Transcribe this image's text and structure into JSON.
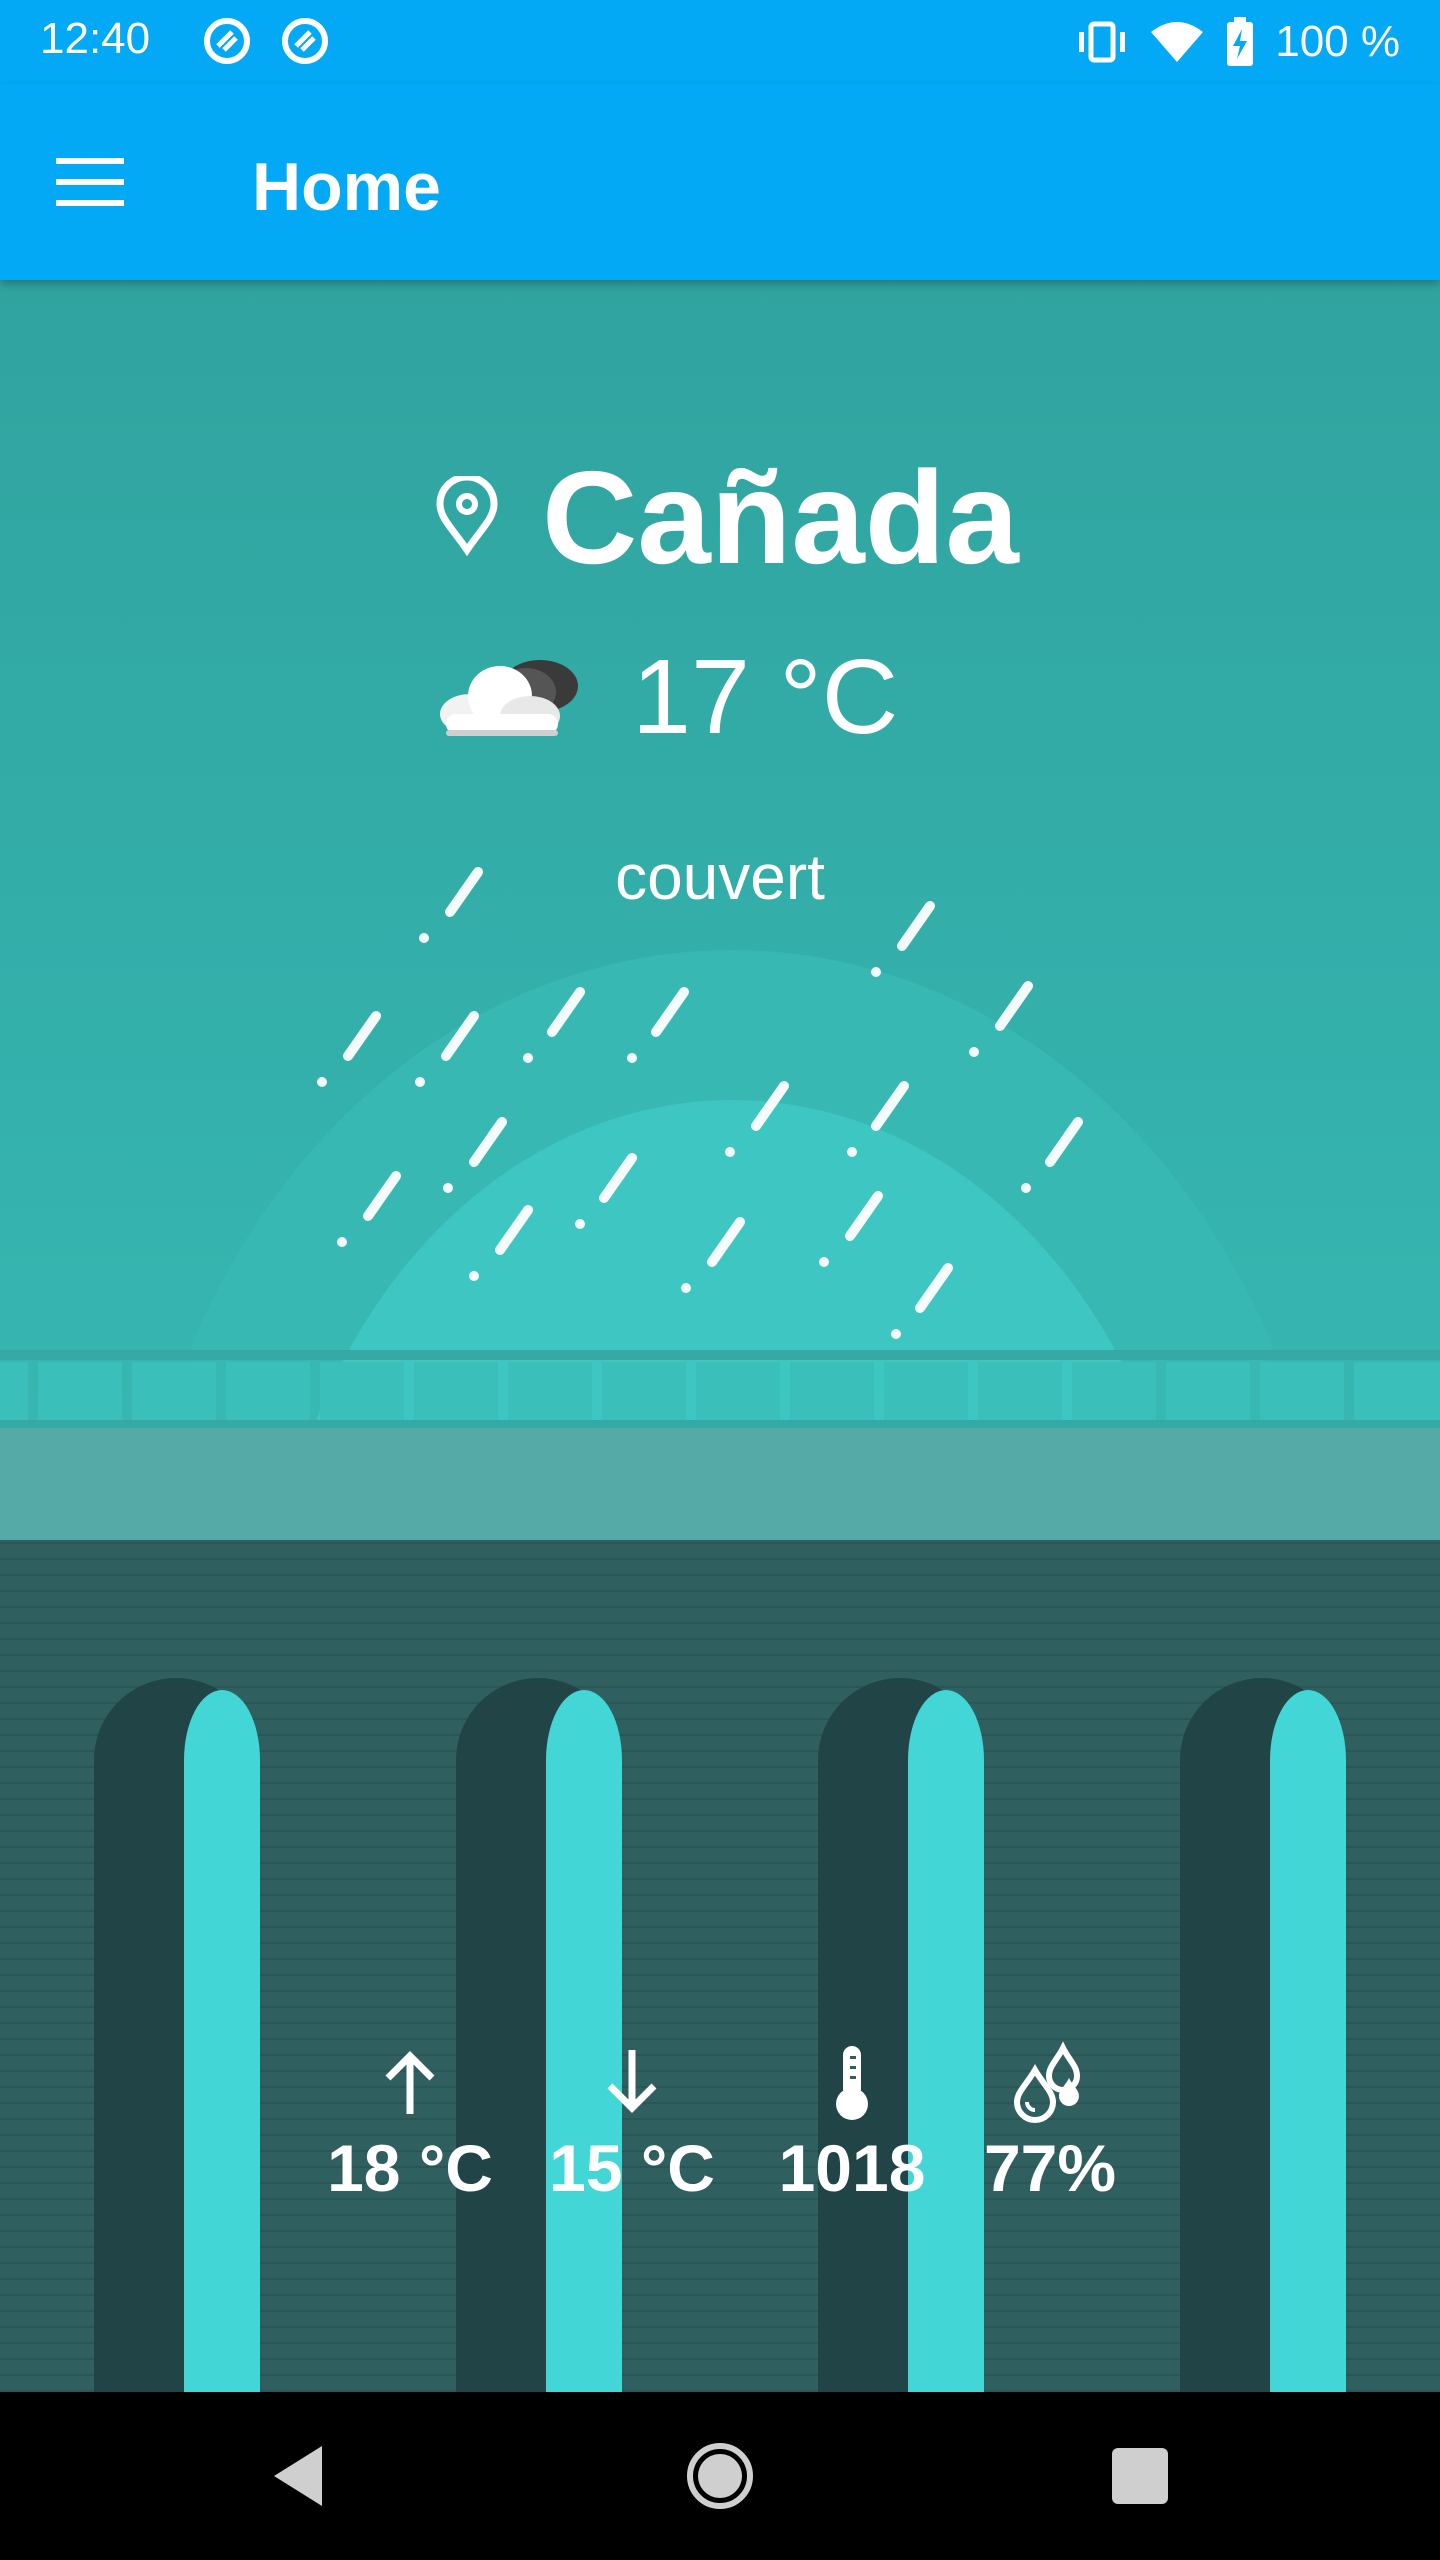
{
  "status_bar": {
    "time": "12:40",
    "battery_text": "100 %",
    "icons": [
      "app-notification-icon",
      "app-notification-icon",
      "vibrate-icon",
      "wifi-icon",
      "battery-charging-icon"
    ]
  },
  "app_bar": {
    "title": "Home",
    "menu_icon": "hamburger-menu-icon"
  },
  "weather": {
    "city": "Cañada",
    "current_temp": "17 °C",
    "condition": "couvert",
    "condition_icon": "cloud-moon-icon"
  },
  "stats": [
    {
      "icon": "arrow-up-icon",
      "value": "18 °C"
    },
    {
      "icon": "arrow-down-icon",
      "value": "15 °C"
    },
    {
      "icon": "thermometer-icon",
      "value": "1018"
    },
    {
      "icon": "humidity-drops-icon",
      "value": "77%"
    }
  ],
  "colors": {
    "app_bar": "#03a9f4",
    "sky": "#30a39f",
    "bridge_dark": "#2f5f5e",
    "column_light": "#43d6d6"
  },
  "nav_bar": {
    "icons": [
      "back-icon",
      "home-icon",
      "recents-icon"
    ]
  }
}
